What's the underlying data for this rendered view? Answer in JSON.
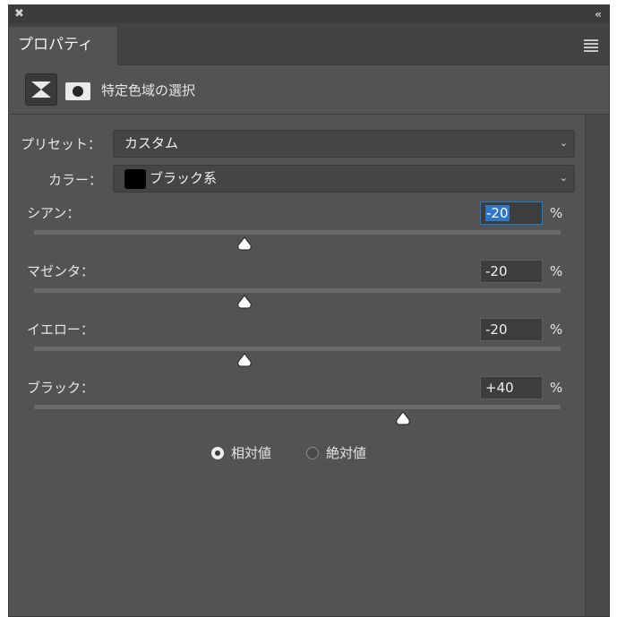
{
  "window": {
    "close_glyph": "✖",
    "collapse_glyph": "‹‹"
  },
  "tab": {
    "label": "プロパティ"
  },
  "header": {
    "title": "特定色域の選択"
  },
  "preset": {
    "label": "プリセット：",
    "value": "カスタム"
  },
  "colors": {
    "label": "カラー：",
    "value": "ブラック系",
    "swatch_color": "#000000"
  },
  "sliders": [
    {
      "label": "シアン：",
      "value": "-20",
      "amount": -20,
      "unit": "%",
      "active": true
    },
    {
      "label": "マゼンタ：",
      "value": "-20",
      "amount": -20,
      "unit": "%",
      "active": false
    },
    {
      "label": "イエロー：",
      "value": "-20",
      "amount": -20,
      "unit": "%",
      "active": false
    },
    {
      "label": "ブラック：",
      "value": "+40",
      "amount": 40,
      "unit": "%",
      "active": false
    }
  ],
  "slider_range": [
    -100,
    100
  ],
  "method": {
    "options": [
      "相対値",
      "絶対値"
    ],
    "selected": "相対値"
  },
  "accent_color": "#2f76c7"
}
